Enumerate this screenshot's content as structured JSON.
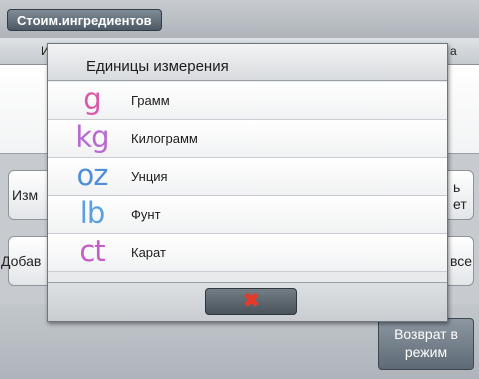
{
  "header": {
    "title": "Стоим.ингредиентов"
  },
  "background": {
    "col_header_left": "И",
    "col_header_right": "а",
    "left_buttons": [
      "Изм",
      "Добав"
    ],
    "right_buttons": [
      "ь\nет",
      "все"
    ],
    "return_button": "Возврат в режим"
  },
  "dialog": {
    "title": "Единицы измерения",
    "units": [
      {
        "icon": "g",
        "label": "Грамм"
      },
      {
        "icon": "kg",
        "label": "Килограмм"
      },
      {
        "icon": "oz",
        "label": "Унция"
      },
      {
        "icon": "lb",
        "label": "Фунт"
      },
      {
        "icon": "ct",
        "label": "Карат"
      }
    ],
    "cancel_icon": "close-icon",
    "cancel_symbol": "✖"
  }
}
